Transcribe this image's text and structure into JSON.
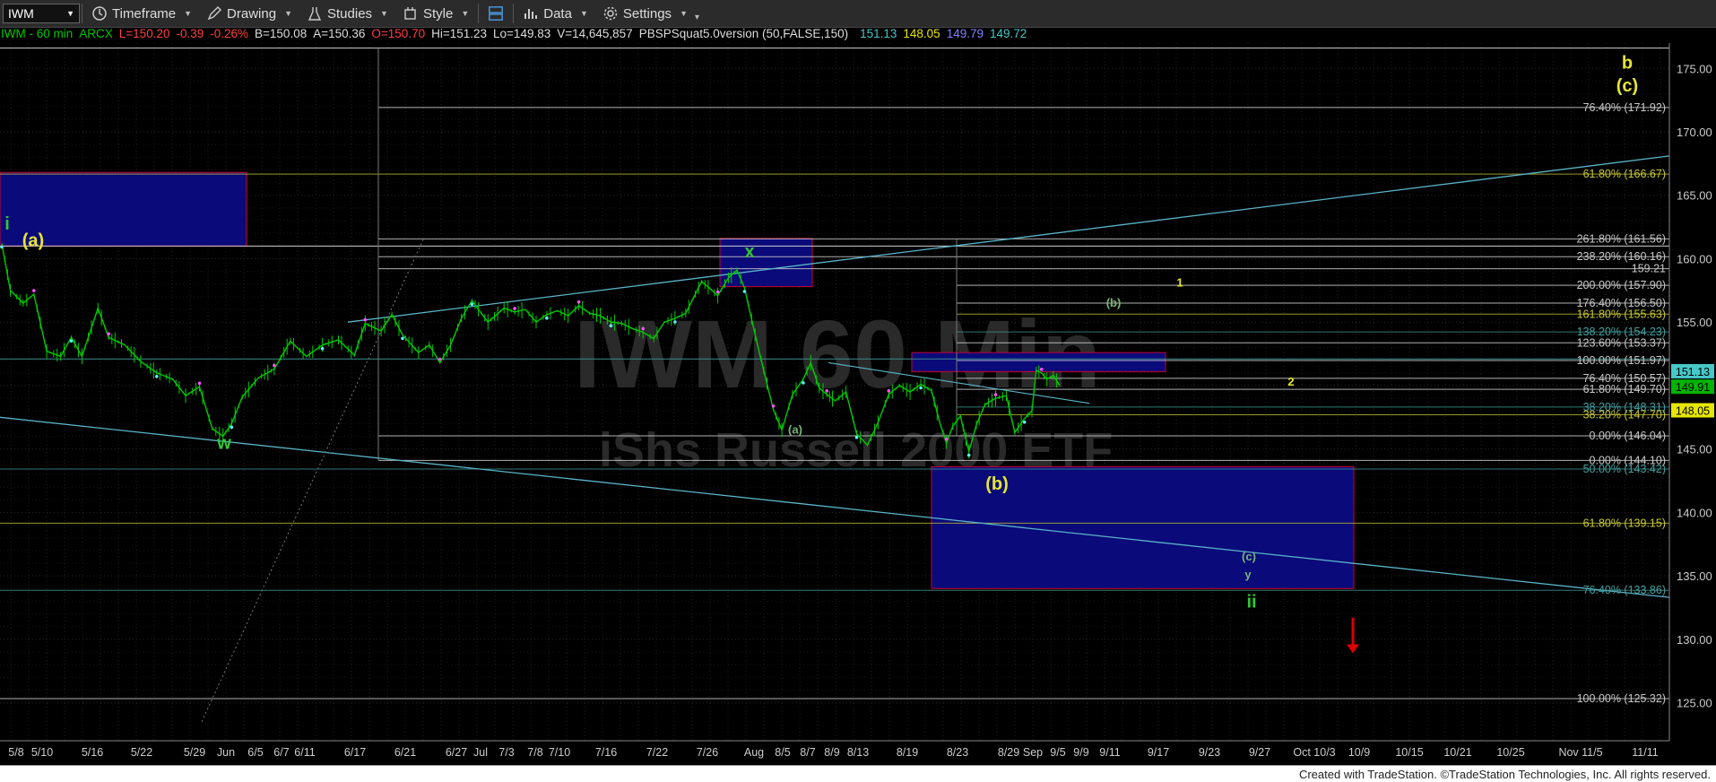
{
  "toolbar": {
    "symbol": "IWM",
    "timeframe": "Timeframe",
    "drawing": "Drawing",
    "studies": "Studies",
    "style": "Style",
    "data": "Data",
    "settings": "Settings"
  },
  "info": {
    "title": "IWM - 60 min",
    "exchange": "ARCX",
    "last": "L=150.20",
    "chg": "-0.39",
    "pct": "-0.26%",
    "bid": "B=150.08",
    "ask": "A=150.36",
    "open": "O=150.70",
    "hi": "Hi=151.23",
    "lo": "Lo=149.83",
    "vol": "V=14,645,857",
    "study": "PBSPSquat5.0version (50,FALSE,150)",
    "study_values": [
      "151.13",
      "148.05",
      "149.79",
      "149.72"
    ]
  },
  "watermark": {
    "symbol": "IWM 60 Min",
    "name": "iShs Russell 2000 ETF"
  },
  "footer": "Created with TradeStation. ©TradeStation Technologies, Inc. All rights reserved.",
  "colors": {
    "up": "#00cc00",
    "box_fill": "#0a0a7a",
    "box_border": "#cc0033",
    "trendline": "#5ab4c8",
    "fib_text": "#c8c8c8",
    "fib_text_yellow": "#c8c832",
    "fib_text_teal": "#46a0a0",
    "label_yellow": "#e6e632",
    "label_green": "#32c832",
    "label_green_light": "#78b478",
    "price_tag_cyan": "#46c8c8",
    "price_tag_green": "#00b400",
    "price_tag_yellow": "#e6e600",
    "arrow": "#dc0000"
  },
  "chart_data": {
    "type": "line",
    "title": "IWM - 60 min",
    "ylim": [
      122,
      177
    ],
    "y_ticks": [
      "125.00",
      "130.00",
      "135.00",
      "140.00",
      "145.00",
      "150.00",
      "155.00",
      "160.00",
      "165.00",
      "170.00",
      "175.00"
    ],
    "x_ticks": [
      "5/8",
      "5/10",
      "5/16",
      "5/22",
      "5/29",
      "Jun",
      "6/5",
      "6/7",
      "6/11",
      "6/17",
      "6/21",
      "6/27",
      "Jul",
      "7/3",
      "7/8",
      "7/10",
      "7/16",
      "7/22",
      "7/26",
      "Aug",
      "8/5",
      "8/7",
      "8/9",
      "8/13",
      "8/19",
      "8/23",
      "8/29",
      "Sep",
      "9/5",
      "9/9",
      "9/11",
      "9/17",
      "9/23",
      "9/27",
      "Oct 10/3",
      "10/9",
      "10/15",
      "10/21",
      "10/25",
      "Nov 11/5",
      "11/11"
    ],
    "series": [
      {
        "values": [
          [
            0,
            161.2
          ],
          [
            8,
            157.5
          ],
          [
            20,
            156.5
          ],
          [
            30,
            157.2
          ],
          [
            42,
            152.7
          ],
          [
            55,
            152.3
          ],
          [
            65,
            153.8
          ],
          [
            75,
            152.3
          ],
          [
            90,
            156.1
          ],
          [
            100,
            153.8
          ],
          [
            115,
            153.2
          ],
          [
            130,
            151.9
          ],
          [
            145,
            151.0
          ],
          [
            160,
            150.5
          ],
          [
            172,
            149.2
          ],
          [
            185,
            149.9
          ],
          [
            197,
            146.6
          ],
          [
            207,
            146.0
          ],
          [
            215,
            147.0
          ],
          [
            225,
            149.1
          ],
          [
            240,
            150.6
          ],
          [
            255,
            151.3
          ],
          [
            270,
            153.5
          ],
          [
            285,
            152.3
          ],
          [
            300,
            153.2
          ],
          [
            315,
            153.6
          ],
          [
            330,
            152.4
          ],
          [
            340,
            154.9
          ],
          [
            355,
            154.3
          ],
          [
            365,
            155.6
          ],
          [
            375,
            154.0
          ],
          [
            390,
            152.6
          ],
          [
            400,
            153.2
          ],
          [
            410,
            151.8
          ],
          [
            420,
            153.2
          ],
          [
            430,
            155.3
          ],
          [
            440,
            156.7
          ],
          [
            455,
            155.0
          ],
          [
            470,
            156.1
          ],
          [
            480,
            155.8
          ],
          [
            490,
            156.0
          ],
          [
            500,
            155.0
          ],
          [
            510,
            155.6
          ],
          [
            520,
            155.9
          ],
          [
            530,
            155.5
          ],
          [
            540,
            156.3
          ],
          [
            550,
            155.7
          ],
          [
            560,
            155.5
          ],
          [
            570,
            155.0
          ],
          [
            580,
            154.9
          ],
          [
            590,
            154.5
          ],
          [
            600,
            154.2
          ],
          [
            610,
            153.7
          ],
          [
            620,
            155.0
          ],
          [
            630,
            155.3
          ],
          [
            640,
            155.7
          ],
          [
            655,
            158.2
          ],
          [
            670,
            157.1
          ],
          [
            680,
            158.5
          ],
          [
            688,
            159.1
          ],
          [
            695,
            157.7
          ],
          [
            705,
            154.0
          ],
          [
            713,
            151.2
          ],
          [
            722,
            148.1
          ],
          [
            730,
            146.5
          ],
          [
            740,
            149.3
          ],
          [
            750,
            150.5
          ],
          [
            757,
            151.8
          ],
          [
            765,
            149.8
          ],
          [
            772,
            149.3
          ],
          [
            780,
            148.8
          ],
          [
            790,
            149.5
          ],
          [
            800,
            146.2
          ],
          [
            810,
            145.3
          ],
          [
            820,
            147.1
          ],
          [
            830,
            149.3
          ],
          [
            840,
            150.0
          ],
          [
            850,
            149.5
          ],
          [
            860,
            150.1
          ],
          [
            870,
            149.6
          ],
          [
            878,
            147.0
          ],
          [
            884,
            145.5
          ],
          [
            890,
            146.8
          ],
          [
            897,
            147.6
          ],
          [
            905,
            144.8
          ],
          [
            912,
            146.9
          ],
          [
            920,
            148.5
          ],
          [
            930,
            149.0
          ],
          [
            940,
            149.2
          ],
          [
            948,
            146.3
          ],
          [
            957,
            147.4
          ],
          [
            964,
            148.0
          ],
          [
            968,
            151.2
          ],
          [
            973,
            151.0
          ],
          [
            978,
            150.5
          ],
          [
            984,
            150.8
          ],
          [
            990,
            150.0
          ]
        ],
        "note_units": "x = hourly bar index"
      }
    ],
    "fib_levels": [
      {
        "label": "76.40% (171.92)",
        "price": 171.92
      },
      {
        "label": "61.80% (166.67)",
        "price": 166.67
      },
      {
        "label": "261.80% (161.56)",
        "price": 161.56
      },
      {
        "label": "238.20% (160.16)",
        "price": 160.16
      },
      {
        "label": "159.21",
        "price": 159.21
      },
      {
        "label": "200.00% (157.90)",
        "price": 157.9
      },
      {
        "label": "176.40% (156.50)",
        "price": 156.5
      },
      {
        "label": "161.80% (155.63)",
        "price": 155.63
      },
      {
        "label": "138.20% (154.23)",
        "price": 154.23
      },
      {
        "label": "123.60% (153.37)",
        "price": 153.37
      },
      {
        "label": "100.00% (151.97)",
        "price": 151.97
      },
      {
        "label": "76.40% (150.57)",
        "price": 150.57
      },
      {
        "label": "61.80% (149.70)",
        "price": 149.7
      },
      {
        "label": "38.20% (148.31)",
        "price": 148.31
      },
      {
        "label": "38.20% (147.70)",
        "price": 147.7
      },
      {
        "label": "0.00% (146.04)",
        "price": 146.04
      },
      {
        "label": "0.00% (144.10)",
        "price": 144.1
      },
      {
        "label": "50.00% (143.42)",
        "price": 143.42
      },
      {
        "label": "61.80% (139.15)",
        "price": 139.15
      },
      {
        "label": "76.40% (133.86)",
        "price": 133.86
      },
      {
        "label": "100.00% (125.32)",
        "price": 125.32
      }
    ],
    "wave_labels": [
      {
        "text": "b",
        "price": 175.0,
        "color": "yellow"
      },
      {
        "text": "(c)",
        "price": 173.2,
        "color": "yellow"
      },
      {
        "text": "i",
        "price": 162.3,
        "color": "green"
      },
      {
        "text": "(a)",
        "price": 161.0,
        "color": "yellow"
      },
      {
        "text": "x",
        "price": 160.1,
        "color": "green"
      },
      {
        "text": "1",
        "price": 157.8,
        "color": "yellow"
      },
      {
        "text": "(b)",
        "price": 156.2,
        "color": "green"
      },
      {
        "text": "2",
        "price": 150.0,
        "color": "yellow"
      },
      {
        "text": "(a)",
        "price": 146.2,
        "color": "green"
      },
      {
        "text": "w",
        "price": 145.0,
        "color": "green"
      },
      {
        "text": "(b)",
        "price": 141.8,
        "color": "yellow"
      },
      {
        "text": "(c)",
        "price": 136.2,
        "color": "green"
      },
      {
        "text": "y",
        "price": 134.8,
        "color": "green"
      },
      {
        "text": "ii",
        "price": 132.5,
        "color": "green"
      }
    ],
    "price_tags": [
      {
        "text": "151.13",
        "price": 151.13,
        "color": "cyan"
      },
      {
        "text": "149.91",
        "price": 149.91,
        "color": "green"
      },
      {
        "text": "148.05",
        "price": 148.05,
        "color": "yellow"
      }
    ],
    "zones": [
      {
        "name": "upper-left",
        "top": 166.8,
        "bottom": 161.0
      },
      {
        "name": "x-box",
        "top": 161.6,
        "bottom": 157.8
      },
      {
        "name": "b-box",
        "top": 152.6,
        "bottom": 151.1
      },
      {
        "name": "target-box",
        "top": 143.6,
        "bottom": 134.0
      }
    ]
  }
}
